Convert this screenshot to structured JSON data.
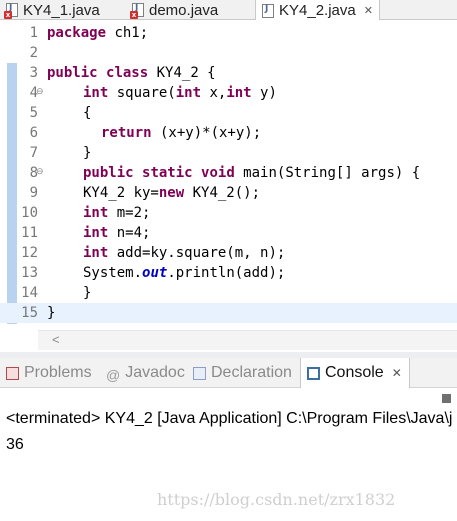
{
  "editor_tabs": [
    {
      "label": "KY4_1.java",
      "has_error": true,
      "active": false
    },
    {
      "label": "demo.java",
      "has_error": true,
      "active": false
    },
    {
      "label": "KY4_2.java",
      "has_error": false,
      "active": true
    }
  ],
  "tab_close_glyph": "✕",
  "code_lines": [
    {
      "num": "1"
    },
    {
      "num": "2"
    },
    {
      "num": "3"
    },
    {
      "num": "4",
      "fold": "⊖"
    },
    {
      "num": "5"
    },
    {
      "num": "6"
    },
    {
      "num": "7"
    },
    {
      "num": "8",
      "fold": "⊖"
    },
    {
      "num": "9"
    },
    {
      "num": "10"
    },
    {
      "num": "11"
    },
    {
      "num": "12"
    },
    {
      "num": "13"
    },
    {
      "num": "14"
    },
    {
      "num": "15"
    }
  ],
  "code": {
    "l1": [
      "package",
      " ch1;"
    ],
    "l3": [
      "public",
      " ",
      "class",
      " KY4_2 {"
    ],
    "l4": [
      "int",
      " square(",
      "int",
      " x,",
      "int",
      " y)"
    ],
    "l5": "{",
    "l6": [
      "return",
      " (x+y)*(x+y);"
    ],
    "l7": "}",
    "l8": [
      "public",
      " ",
      "static",
      " ",
      "void",
      " main(String[] args) {"
    ],
    "l9": [
      "KY4_2 ky=",
      "new",
      " KY4_2();"
    ],
    "l10": [
      "int",
      " m=2;"
    ],
    "l11": [
      "int",
      " n=4;"
    ],
    "l12": [
      "int",
      " add=ky.square(m, n);"
    ],
    "l13": [
      "System.",
      "out",
      ".println(add);"
    ],
    "l14": "}",
    "l15": "}"
  },
  "views": {
    "problems": "Problems",
    "javadoc": "Javadoc",
    "javadoc_glyph": "@",
    "declaration": "Declaration",
    "console": "Console"
  },
  "console": {
    "terminated": "<terminated> KY4_2 [Java Application] C:\\Program Files\\Java\\j",
    "output": "36"
  },
  "scroll_left_glyph": "<",
  "watermark": "https://blog.csdn.net/zrx1832",
  "colors": {
    "keyword": "#7f0055",
    "static_field": "#0000c0",
    "line_number": "#787878"
  }
}
